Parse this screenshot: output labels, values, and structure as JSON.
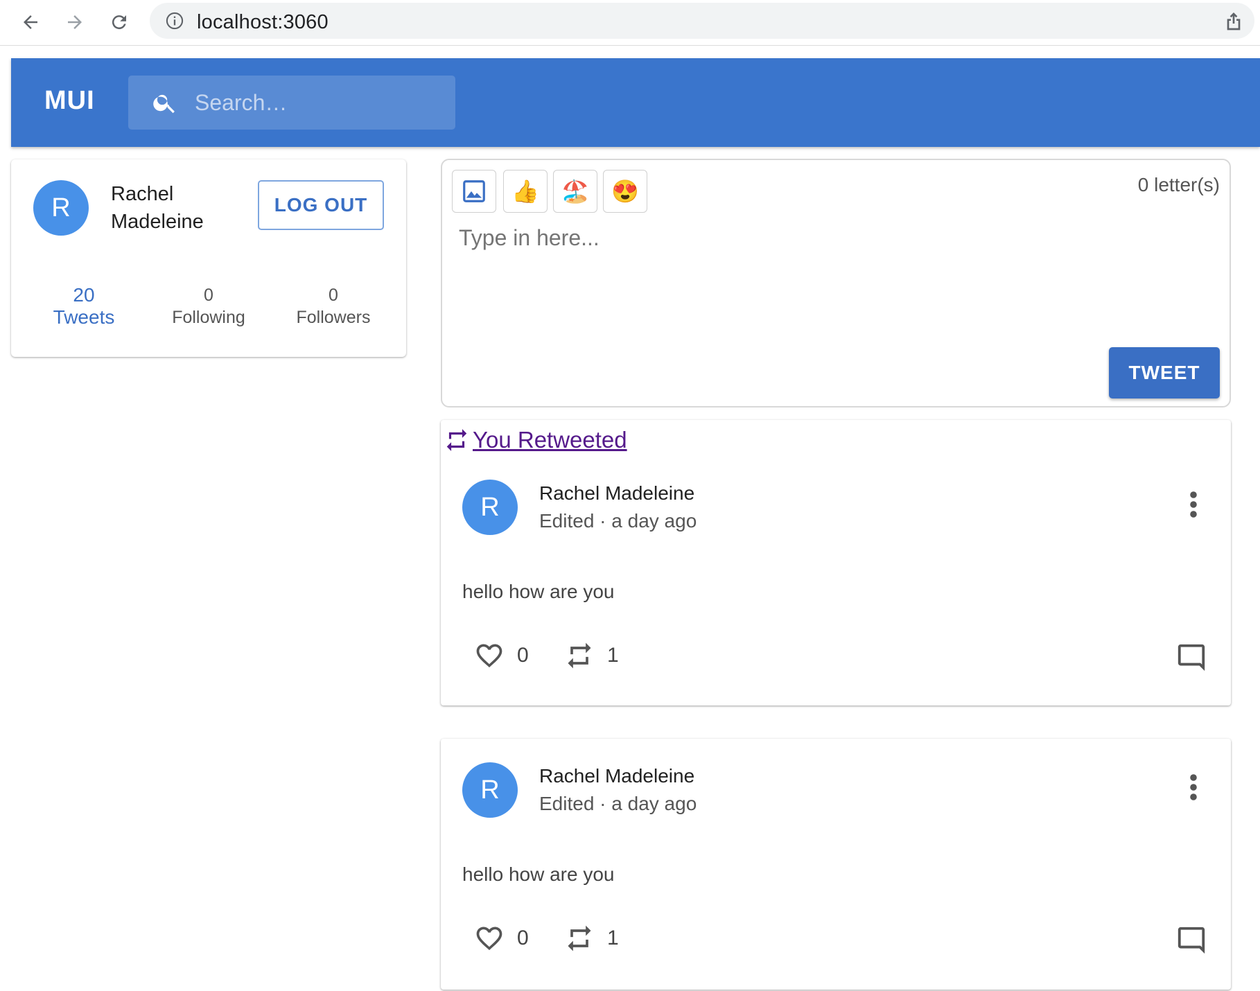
{
  "browser": {
    "url": "localhost:3060"
  },
  "appbar": {
    "brand": "MUI",
    "search_placeholder": "Search…"
  },
  "profile": {
    "avatar_initial": "R",
    "name": "Rachel Madeleine",
    "logout_label": "LOG OUT",
    "stats": {
      "tweets": {
        "count": "20",
        "label": "Tweets"
      },
      "following": {
        "count": "0",
        "label": "Following"
      },
      "followers": {
        "count": "0",
        "label": "Followers"
      }
    }
  },
  "composer": {
    "letter_count": "0 letter(s)",
    "placeholder": "Type in here...",
    "tweet_label": "TWEET",
    "emojis": {
      "thumbs_up": "👍",
      "beach": "🏖️",
      "heart_eyes": "😍"
    }
  },
  "feed": {
    "retweet_banner": "You Retweeted",
    "tweets": [
      {
        "avatar_initial": "R",
        "author": "Rachel Madeleine",
        "meta": "Edited · a day ago",
        "body": "hello how are you",
        "likes": "0",
        "retweets": "1"
      },
      {
        "avatar_initial": "R",
        "author": "Rachel Madeleine",
        "meta": "Edited · a day ago",
        "body": "hello how are you",
        "likes": "0",
        "retweets": "1"
      }
    ]
  },
  "colors": {
    "appbar": "#3a75cc",
    "avatar": "#4891e8",
    "primary": "#3a6fc4",
    "visited_link": "#551a8b"
  }
}
